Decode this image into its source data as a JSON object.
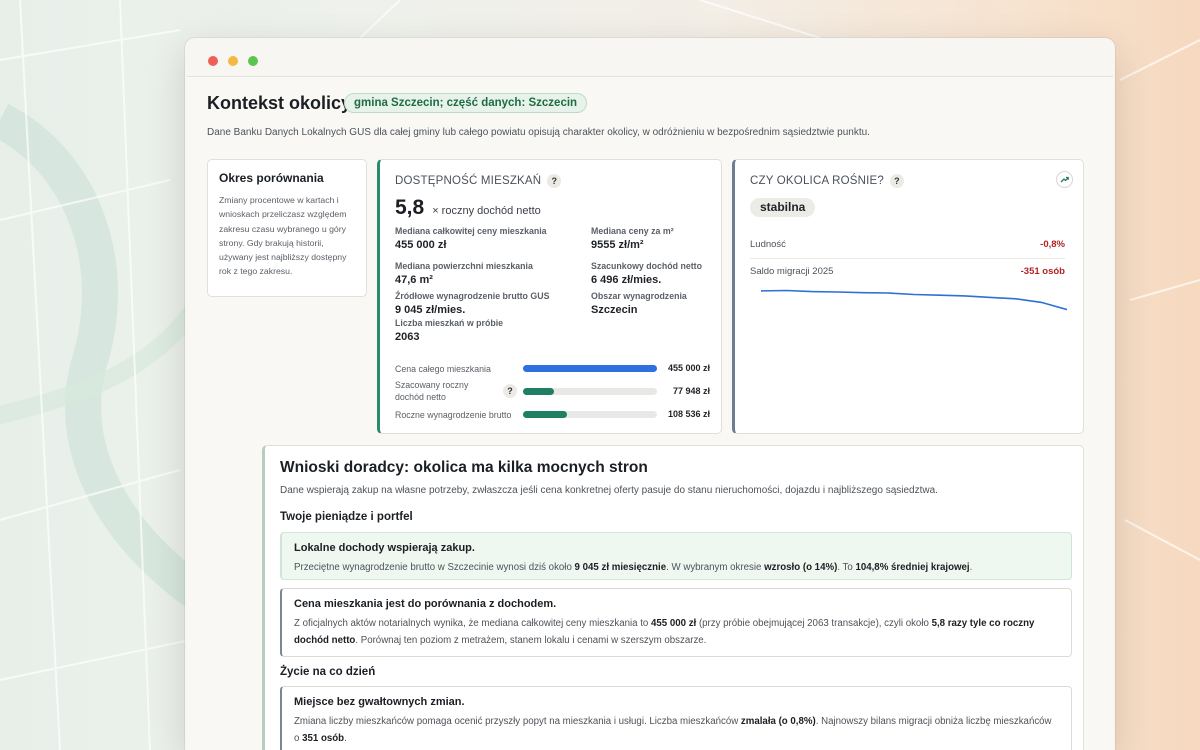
{
  "header": {
    "title": "Kontekst okolicy",
    "badge": "gmina Szczecin; część danych: Szczecin",
    "description": "Dane Banku Danych Lokalnych GUS dla całej gminy lub całego powiatu opisują charakter okolicy, w odróżnieniu w bezpośrednim sąsiedztwie punktu."
  },
  "period": {
    "title": "Okres porównania",
    "text": "Zmiany procentowe w kartach i wnioskach przeliczasz względem zakresu czasu wybranego u góry strony. Gdy brakują historii, używany jest najbliższy dostępny rok z tego zakresu."
  },
  "affordability": {
    "heading": "DOSTĘPNOŚĆ MIESZKAŃ",
    "help": "?",
    "big_value": "5,8",
    "big_unit": "× roczny dochód netto",
    "stats": [
      {
        "label": "Mediana całkowitej ceny mieszkania",
        "value": "455 000 zł"
      },
      {
        "label": "Mediana ceny za m²",
        "value": "9555 zł/m²"
      },
      {
        "label": "Mediana powierzchni mieszkania",
        "value": "47,6 m²"
      },
      {
        "label": "Szacunkowy dochód netto",
        "value": "6 496 zł/mies."
      },
      {
        "label": "Źródłowe wynagrodzenie brutto GUS",
        "value": "9 045 zł/mies."
      },
      {
        "label": "Obszar wynagrodzenia",
        "value": "Szczecin"
      },
      {
        "label": "Liczba mieszkań w próbie",
        "value": "2063"
      }
    ],
    "bars": [
      {
        "label": "Cena całego mieszkania",
        "value": "455 000 zł",
        "fraction": 1.0,
        "color": "#2f6fe0",
        "help": ""
      },
      {
        "label": "Szacowany roczny dochód netto",
        "value": "77 948 zł",
        "fraction": 0.23,
        "color": "#1f7f63",
        "help": "?"
      },
      {
        "label": "Roczne wynagrodzenie brutto",
        "value": "108 536 zł",
        "fraction": 0.33,
        "color": "#1f7f63",
        "help": ""
      }
    ]
  },
  "growth": {
    "heading": "CZY OKOLICA ROŚNIE?",
    "help": "?",
    "icon": "trending-up-icon",
    "status": "stabilna",
    "rows": [
      {
        "label": "Ludność",
        "value": "-0,8%"
      },
      {
        "label": "Saldo migracji 2025",
        "value": "-351 osób"
      }
    ],
    "sparkline": [
      0.92,
      0.93,
      0.9,
      0.89,
      0.87,
      0.86,
      0.82,
      0.8,
      0.78,
      0.74,
      0.7,
      0.6,
      0.4
    ],
    "line_color": "#2f6fd6"
  },
  "advice": {
    "title": "Wnioski doradcy: okolica ma kilka mocnych stron",
    "description": "Dane wspierają zakup na własne potrzeby, zwłaszcza jeśli cena konkretnej oferty pasuje do stanu nieruchomości, dojazdu i najbliższego sąsiedztwa.",
    "section1": "Twoje pieniądze i portfel",
    "note1_title": "Lokalne dochody wspierają zakup.",
    "note1": [
      "Przeciętne wynagrodzenie brutto w Szczecinie wynosi dziś około ",
      "9 045 zł miesięcznie",
      ". W wybranym okresie ",
      "wzrosło (o 14%)",
      ". To ",
      "104,8% średniej krajowej",
      "."
    ],
    "note2_title": "Cena mieszkania jest do porównania z dochodem.",
    "note2": [
      "Z oficjalnych aktów notarialnych wynika, że mediana całkowitej ceny mieszkania to ",
      "455 000 zł",
      " (przy próbie obejmującej 2063 transakcje), czyli około ",
      "5,8 razy tyle co roczny dochód netto",
      ". Porównaj ten poziom z metrażem, stanem lokalu i cenami w szerszym obszarze."
    ],
    "section2": "Życie na co dzień",
    "note3_title": "Miejsce bez gwałtownych zmian.",
    "note3": [
      "Zmiana liczby mieszkańców pomaga ocenić przyszły popyt na mieszkania i usługi. Liczba mieszkańców ",
      "zmalała (o 0,8%)",
      ". Najnowszy bilans migracji obniża liczbę mieszkańców o ",
      "351 osób",
      "."
    ]
  }
}
